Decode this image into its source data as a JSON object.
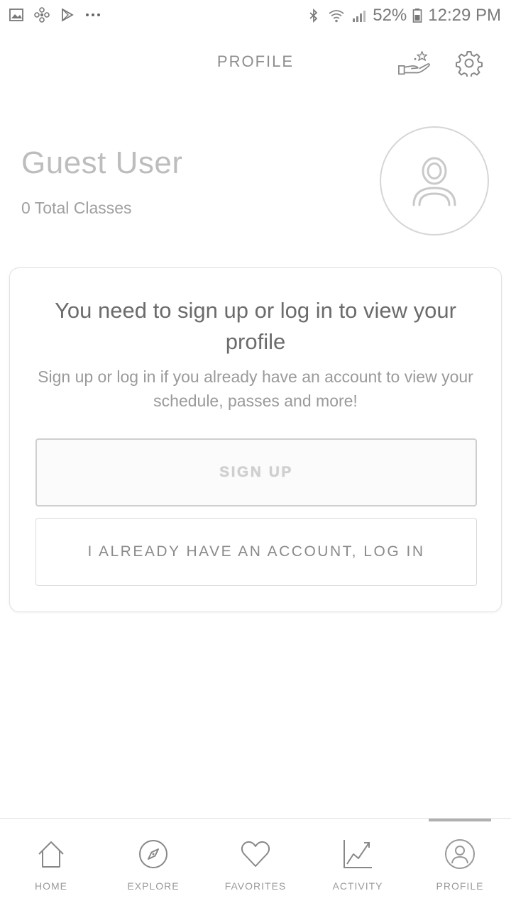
{
  "status_bar": {
    "battery_percent": "52%",
    "time": "12:29 PM",
    "icons": [
      "image-icon",
      "pinwheel-icon",
      "play-store-icon",
      "more-dots-icon",
      "bluetooth-icon",
      "wifi-icon",
      "signal-icon",
      "battery-icon"
    ]
  },
  "header": {
    "title": "PROFILE",
    "icons": [
      "rewards-hand-star-icon",
      "gear-icon"
    ]
  },
  "profile": {
    "name": "Guest User",
    "total_classes": "0 Total Classes",
    "avatar_icon": "user-avatar-icon"
  },
  "card": {
    "title": "You need to sign up or log in to view your profile",
    "subtitle": "Sign up or log in if you already have an account to view your schedule, passes and more!",
    "signup_label": "SIGN UP",
    "login_label": "I ALREADY HAVE AN ACCOUNT, LOG IN"
  },
  "bottom_nav": {
    "items": [
      {
        "label": "HOME",
        "icon": "home-icon"
      },
      {
        "label": "EXPLORE",
        "icon": "compass-icon"
      },
      {
        "label": "FAVORITES",
        "icon": "heart-icon"
      },
      {
        "label": "ACTIVITY",
        "icon": "chart-icon"
      },
      {
        "label": "PROFILE",
        "icon": "profile-icon"
      }
    ],
    "active": "PROFILE"
  }
}
